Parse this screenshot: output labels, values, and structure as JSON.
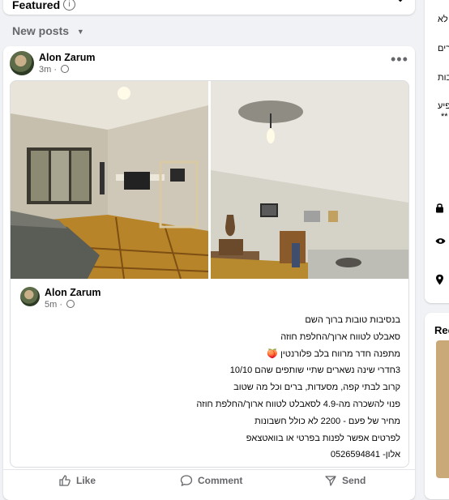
{
  "featured": {
    "label": "Featured",
    "info_glyph": "i"
  },
  "feed_sort": {
    "label": "New posts"
  },
  "post": {
    "author": "Alon Zarum",
    "time": "3m",
    "shared": {
      "author": "Alon Zarum",
      "time": "5m",
      "text_lines": [
        "בנסיבות טובות ברוך השם",
        "סאבלט לטווח ארוך/החלפת חוזה",
        "מתפנה חדר מרווח בלב פלורנטין 🍑",
        "3חדרי שינה נשארים שתיי שותפים שהם 10/10",
        "קרוב לבתי קפה, מסעדות, ברים וכל מה שטוב",
        "פנוי להשכרה מה-4.9 לסאבלט לטווח ארוך/החלפת חוזה",
        "מחיר של פעם - 2200 לא כולל חשבונות",
        "לפרטים אפשר לפנות בפרטי או בוואטצאפ",
        "אלון- 0526594841"
      ]
    },
    "actions": {
      "like": "Like",
      "comment": "Comment",
      "send": "Send"
    }
  },
  "right_panel": {
    "text_fragments": [
      "לא",
      "רים",
      "בות",
      "פיע",
      "**"
    ],
    "heading_fragment": "Rec"
  }
}
